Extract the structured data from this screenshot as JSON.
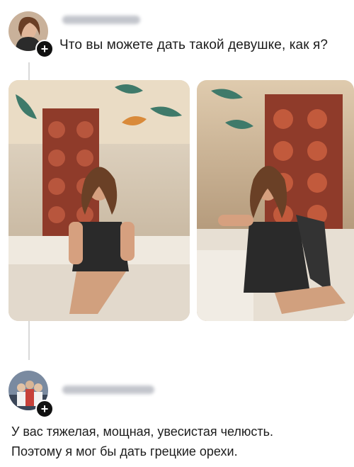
{
  "post": {
    "author_avatar_icon": "user-avatar-woman",
    "follow_icon": "plus-icon",
    "text": "Что вы можете дать такой девушке, как я?",
    "images": [
      {
        "icon": "photo-woman-seated-restaurant-1"
      },
      {
        "icon": "photo-woman-seated-restaurant-2"
      }
    ]
  },
  "reply": {
    "author_avatar_icon": "user-avatar-group",
    "follow_icon": "plus-icon",
    "lines": [
      "У вас тяжелая, мощная, увесистая челюсть.",
      "Поэтому я мог бы дать грецкие орехи."
    ]
  },
  "colors": {
    "accent": "#111111",
    "thread_line": "#d9d9d9",
    "text": "#1c1c1c"
  }
}
